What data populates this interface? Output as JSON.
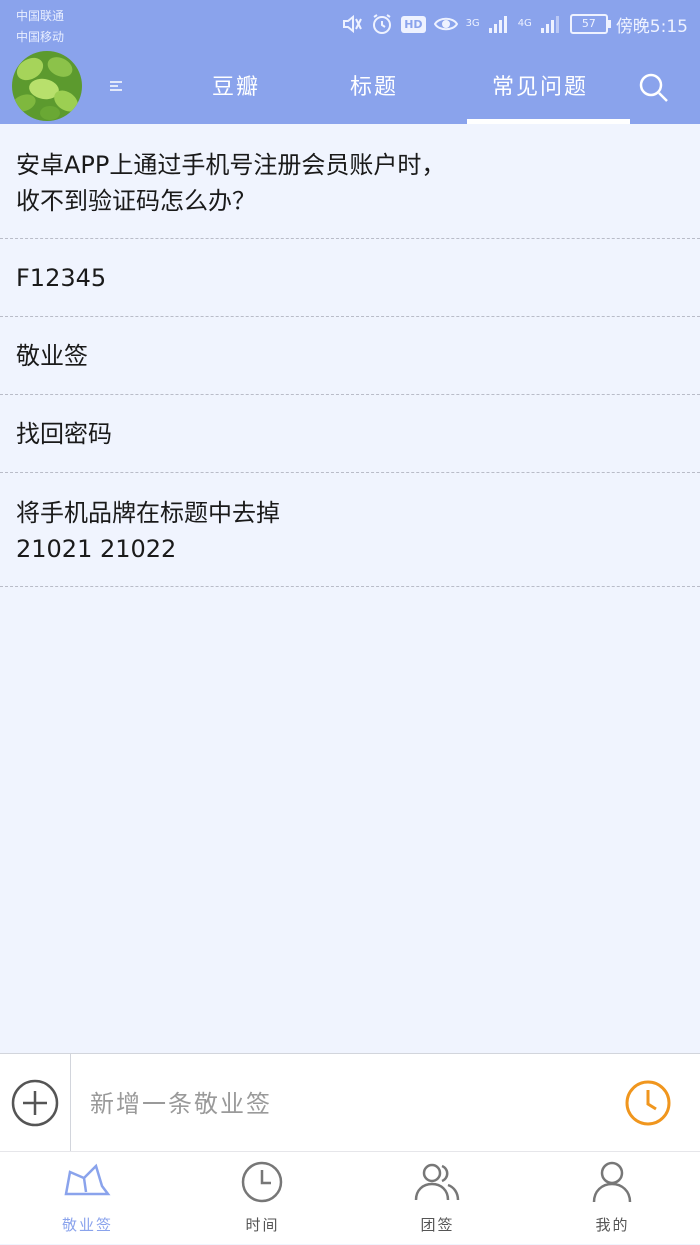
{
  "status_bar": {
    "carriers": [
      "中国联通",
      "中国移动"
    ],
    "network_1": "3G",
    "network_2": "4G",
    "hd": "HD",
    "battery": "57",
    "time": "傍晚5:15"
  },
  "header": {
    "tabs": [
      {
        "label": "豆瓣",
        "active": false
      },
      {
        "label": "标题",
        "active": false
      },
      {
        "label": "常见问题",
        "active": true
      }
    ],
    "icons": {
      "avatar": "leaf-avatar",
      "sort": "sort-icon",
      "search": "search-icon"
    }
  },
  "items": [
    {
      "lines": [
        "安卓APP上通过手机号注册会员账户时，",
        "收不到验证码怎么办？"
      ]
    },
    {
      "lines": [
        "F12345"
      ]
    },
    {
      "lines": [
        "敬业签"
      ]
    },
    {
      "lines": [
        "找回密码"
      ]
    },
    {
      "lines": [
        "将手机品牌在标题中去掉",
        "21021  21022"
      ]
    }
  ],
  "composer": {
    "placeholder": "新增一条敬业签",
    "value": ""
  },
  "bottom_nav": [
    {
      "label": "敬业签",
      "icon": "note-icon",
      "active": true
    },
    {
      "label": "时间",
      "icon": "clock-icon",
      "active": false
    },
    {
      "label": "团签",
      "icon": "group-icon",
      "active": false
    },
    {
      "label": "我的",
      "icon": "person-icon",
      "active": false
    }
  ],
  "colors": {
    "accent": "#8aa3ec",
    "clock": "#f0961e",
    "background": "#f0f4fe"
  }
}
